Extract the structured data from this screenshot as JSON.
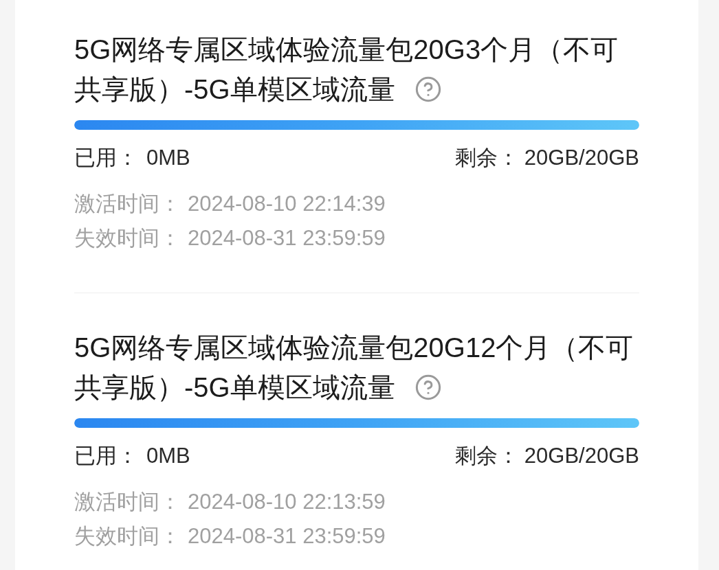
{
  "packages": [
    {
      "title_lines": [
        "5G网络专属区域体验流量包20G3个月（不可",
        "共享版）-5G单模区域流量"
      ],
      "level": 1,
      "used_label": "已用：",
      "used_value": "0MB",
      "remaining_label": "剩余：",
      "remaining_value": "20GB/20GB",
      "times": [
        {
          "label": "激活时间：",
          "value": "2024-08-10 22:14:39"
        },
        {
          "label": "失效时间：",
          "value": "2024-08-31 23:59:59"
        }
      ]
    },
    {
      "title_lines": [
        "5G网络专属区域体验流量包20G12个月（不可",
        "共享版）-5G单模区域流量"
      ],
      "level": 1,
      "used_label": "已用：",
      "used_value": "0MB",
      "remaining_label": "剩余：",
      "remaining_value": "20GB/20GB",
      "times": [
        {
          "label": "激活时间：",
          "value": "2024-08-10 22:13:59"
        },
        {
          "label": "失效时间：",
          "value": "2024-08-31 23:59:59"
        }
      ]
    }
  ]
}
